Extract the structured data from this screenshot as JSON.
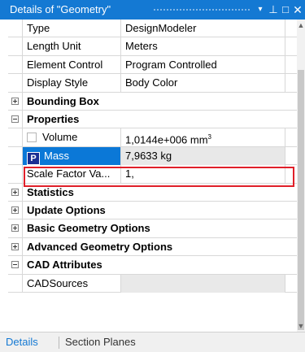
{
  "panel": {
    "title": "Details of \"Geometry\"",
    "controls": {
      "dropdown": "▾",
      "pin": "⊥",
      "maximize": "□",
      "close": "✕"
    }
  },
  "rows": [
    {
      "kind": "property",
      "name": "Type",
      "value": "DesignModeler"
    },
    {
      "kind": "property",
      "name": "Length Unit",
      "value": "Meters"
    },
    {
      "kind": "property",
      "name": "Element Control",
      "value": "Program Controlled"
    },
    {
      "kind": "property",
      "name": "Display Style",
      "value": "Body Color"
    },
    {
      "kind": "group",
      "name": "Bounding Box",
      "expanded": false
    },
    {
      "kind": "group",
      "name": "Properties",
      "expanded": true
    },
    {
      "kind": "property",
      "name": "Volume",
      "value": "1,0144e+006 mm",
      "value_sup": "3",
      "checkbox": true
    },
    {
      "kind": "property",
      "name": "Mass",
      "value": "7,9633 kg",
      "badge": "P",
      "selected": true
    },
    {
      "kind": "property",
      "name": "Scale Factor Va...",
      "value": "1,"
    },
    {
      "kind": "group",
      "name": "Statistics",
      "expanded": false
    },
    {
      "kind": "group",
      "name": "Update Options",
      "expanded": false
    },
    {
      "kind": "group",
      "name": "Basic Geometry Options",
      "expanded": false
    },
    {
      "kind": "group",
      "name": "Advanced Geometry Options",
      "expanded": false
    },
    {
      "kind": "group",
      "name": "CAD Attributes",
      "expanded": true
    },
    {
      "kind": "property",
      "name": "CADSources",
      "value": ""
    }
  ],
  "tabs": [
    {
      "label": "Details",
      "active": true
    },
    {
      "label": "Section Planes",
      "active": false
    }
  ],
  "colors": {
    "title_bar": "#1479d3",
    "selection": "#0b78d7",
    "highlight_border": "#e0202a",
    "badge": "#1a2f93"
  }
}
